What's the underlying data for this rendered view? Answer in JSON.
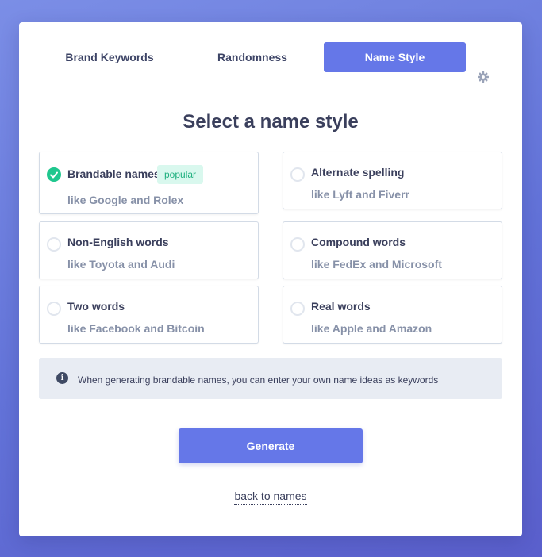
{
  "tabs": {
    "brand_keywords": "Brand Keywords",
    "randomness": "Randomness",
    "name_style": "Name Style",
    "settings_icon": "gear-icon"
  },
  "title": "Select a name style",
  "options": [
    {
      "label": "Brandable names",
      "example": "like Google and Rolex",
      "badge": "popular",
      "selected": true
    },
    {
      "label": "Alternate spelling",
      "example": "like Lyft and Fiverr",
      "selected": false
    },
    {
      "label": "Non-English words",
      "example": "like Toyota and Audi",
      "selected": false
    },
    {
      "label": "Compound words",
      "example": "like FedEx and Microsoft",
      "selected": false
    },
    {
      "label": "Two words",
      "example": "like Facebook and Bitcoin",
      "selected": false
    },
    {
      "label": "Real words",
      "example": "like Apple and Amazon",
      "selected": false
    }
  ],
  "info": {
    "icon": "info-icon",
    "text": "When generating brandable names, you can enter your own name ideas as keywords"
  },
  "generate_label": "Generate",
  "back_label": "back to names",
  "colors": {
    "accent": "#6577e8",
    "check": "#1fc78e",
    "badge_bg": "#d9f8ee",
    "badge_text": "#20b07f"
  }
}
